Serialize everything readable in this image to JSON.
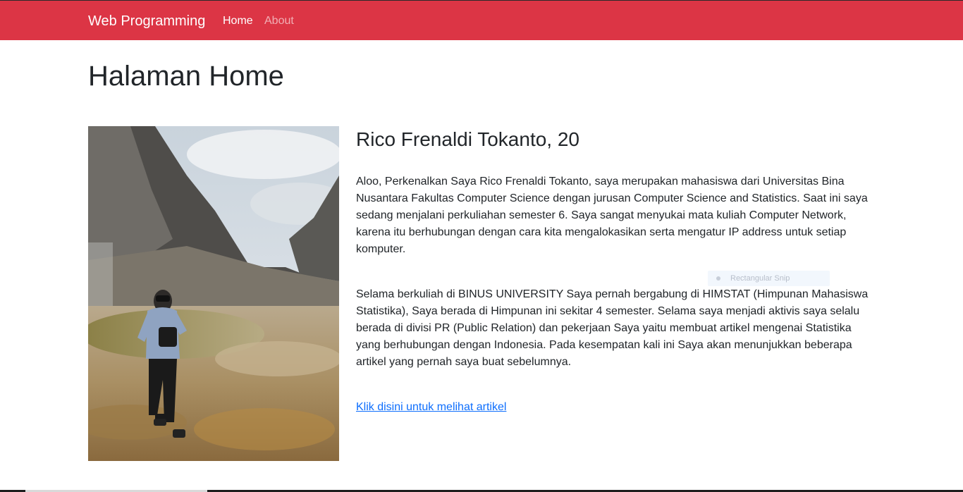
{
  "navbar": {
    "brand": "Web Programming",
    "links": [
      {
        "label": "Home",
        "active": true
      },
      {
        "label": "About",
        "active": false
      }
    ],
    "color": "#dc3545"
  },
  "page": {
    "title": "Halaman Home"
  },
  "profile": {
    "name": "Rico Frenaldi Tokanto, 20",
    "paragraph1": "Aloo, Perkenalkan Saya Rico Frenaldi Tokanto, saya merupakan mahasiswa dari Universitas Bina Nusantara Fakultas Computer Science dengan jurusan Computer Science and Statistics. Saat ini saya sedang menjalani perkuliahan semester 6. Saya sangat menyukai mata kuliah Computer Network, karena itu berhubungan dengan cara kita mengalokasikan serta mengatur IP address untuk setiap komputer.",
    "paragraph2": "Selama berkuliah di BINUS UNIVERSITY Saya pernah bergabung di HIMSTAT (Himpunan Mahasiswa Statistika), Saya berada di Himpunan ini sekitar 4 semester. Selama saya menjadi aktivis saya selalu berada di divisi PR (Public Relation) dan pekerjaan Saya yaitu membuat artikel mengenai Statistika yang berhubungan dengan Indonesia. Pada kesempatan kali ini Saya akan menunjukkan beberapa artikel yang pernah saya buat sebelumnya.",
    "link_label": "Klik disini untuk melihat artikel",
    "link_color": "#0d6efd"
  },
  "overlay": {
    "snip_label": "Rectangular Snip"
  }
}
